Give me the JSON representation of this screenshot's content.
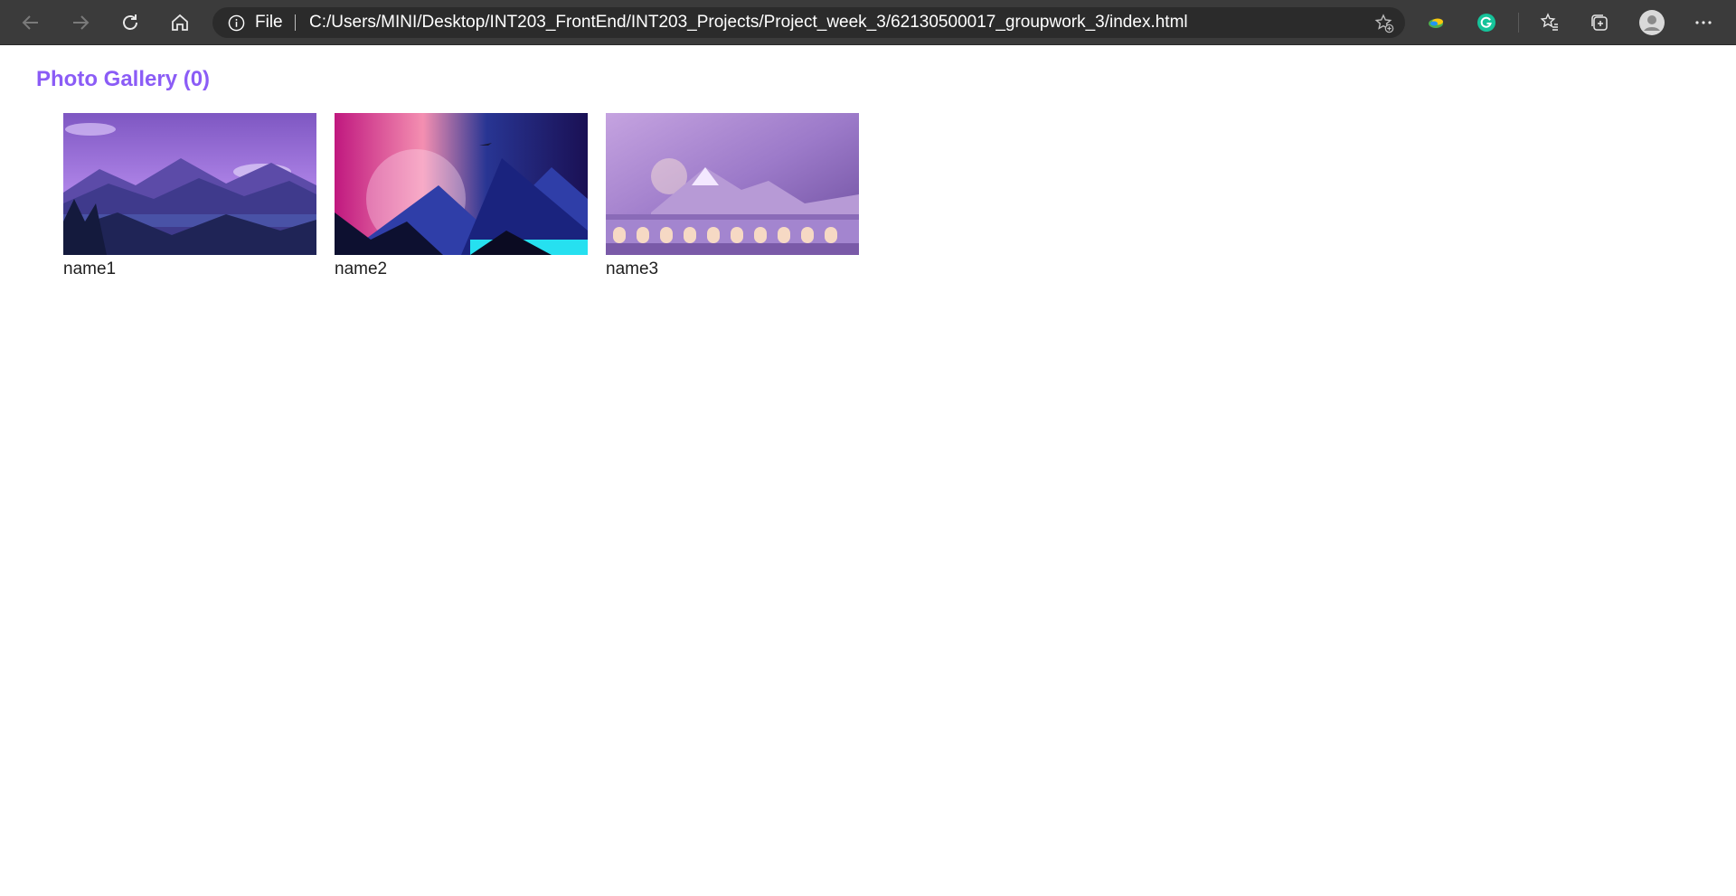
{
  "browser": {
    "address": {
      "scheme_label": "File",
      "url": "C:/Users/MINI/Desktop/INT203_FrontEnd/INT203_Projects/Project_week_3/62130500017_groupwork_3/index.html"
    },
    "icons": {
      "back": "arrow-left",
      "forward": "arrow-right",
      "refresh": "refresh",
      "home": "home",
      "info": "info-circle",
      "add_favorite": "star-plus",
      "extension_1": "extension-logo",
      "extension_grammarly": "grammarly-g",
      "favorites": "favorites-list",
      "collections": "collections",
      "profile": "avatar",
      "menu": "more-horizontal"
    },
    "colors": {
      "toolbar_bg": "#3b3b3b",
      "address_bg": "#2b2b2b",
      "grammarly": "#15c39a"
    }
  },
  "page": {
    "title": "Photo Gallery (0)",
    "title_color": "#8b5cf6",
    "photos": [
      {
        "name": "name1",
        "theme": "purple-mountains-lake"
      },
      {
        "name": "name2",
        "theme": "neon-sunset-mountains"
      },
      {
        "name": "name3",
        "theme": "viaduct-train-mountains"
      }
    ]
  }
}
